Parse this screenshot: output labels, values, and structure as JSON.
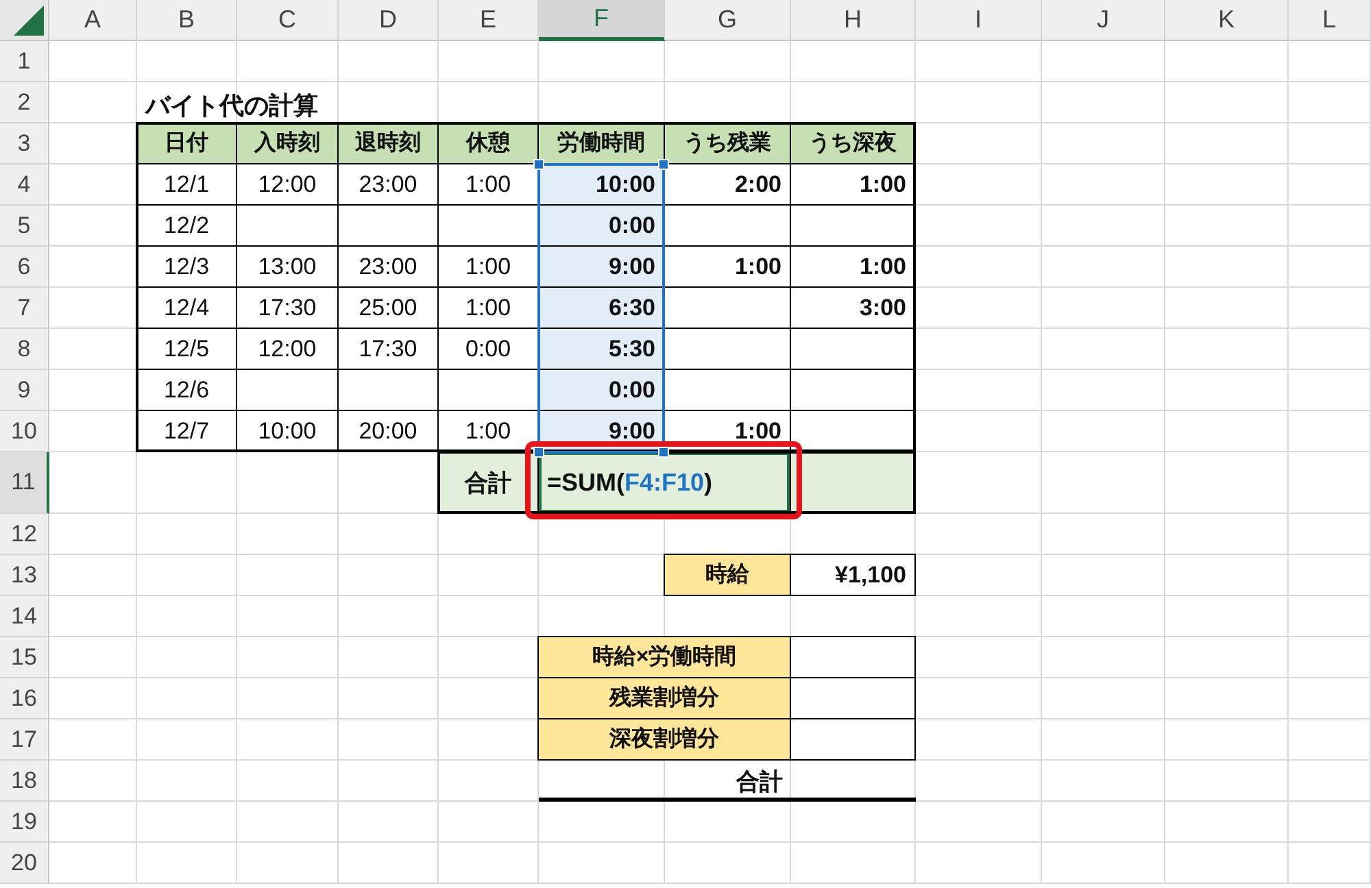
{
  "columns": [
    {
      "letter": "A",
      "selected": false
    },
    {
      "letter": "B",
      "selected": false
    },
    {
      "letter": "C",
      "selected": false
    },
    {
      "letter": "D",
      "selected": false
    },
    {
      "letter": "E",
      "selected": false
    },
    {
      "letter": "F",
      "selected": true
    },
    {
      "letter": "G",
      "selected": false
    },
    {
      "letter": "H",
      "selected": false
    },
    {
      "letter": "I",
      "selected": false
    },
    {
      "letter": "J",
      "selected": false
    },
    {
      "letter": "K",
      "selected": false
    },
    {
      "letter": "L",
      "selected": false
    }
  ],
  "rows": [
    {
      "number": "1",
      "selected": false
    },
    {
      "number": "2",
      "selected": false,
      "cells": [
        null,
        {
          "kind": "title",
          "text": "バイト代の計算",
          "selected": false
        }
      ]
    },
    {
      "number": "3",
      "selected": false,
      "cells": [
        null,
        {
          "kind": "head",
          "text": "日付",
          "selected": false
        },
        {
          "kind": "head",
          "text": "入時刻",
          "selected": false
        },
        {
          "kind": "head",
          "text": "退時刻",
          "selected": false
        },
        {
          "kind": "head",
          "text": "休憩",
          "selected": false
        },
        {
          "kind": "head",
          "text": "労働時間",
          "selected": false
        },
        {
          "kind": "head",
          "text": "うち残業",
          "selected": false
        },
        {
          "kind": "head",
          "text": "うち深夜",
          "selected": false
        }
      ]
    },
    {
      "number": "4",
      "selected": false,
      "cells": [
        null,
        {
          "kind": "entry",
          "text": "12/1",
          "selected": false
        },
        {
          "kind": "entry",
          "text": "12:00",
          "selected": false
        },
        {
          "kind": "entry",
          "text": "23:00",
          "selected": false
        },
        {
          "kind": "entry",
          "text": "1:00",
          "selected": false
        },
        {
          "kind": "calc",
          "text": "10:00",
          "selected": true
        },
        {
          "kind": "calc",
          "text": "2:00",
          "selected": false
        },
        {
          "kind": "calc",
          "text": "1:00",
          "selected": false
        }
      ]
    },
    {
      "number": "5",
      "selected": false,
      "cells": [
        null,
        {
          "kind": "entry",
          "text": "12/2",
          "selected": false
        },
        {
          "kind": "entry",
          "selected": false
        },
        {
          "kind": "entry",
          "selected": false
        },
        {
          "kind": "entry",
          "selected": false
        },
        {
          "kind": "calc",
          "text": "0:00",
          "selected": true
        },
        {
          "kind": "calc",
          "selected": false
        },
        {
          "kind": "calc",
          "selected": false
        }
      ]
    },
    {
      "number": "6",
      "selected": false,
      "cells": [
        null,
        {
          "kind": "entry",
          "text": "12/3",
          "selected": false
        },
        {
          "kind": "entry",
          "text": "13:00",
          "selected": false
        },
        {
          "kind": "entry",
          "text": "23:00",
          "selected": false
        },
        {
          "kind": "entry",
          "text": "1:00",
          "selected": false
        },
        {
          "kind": "calc",
          "text": "9:00",
          "selected": true
        },
        {
          "kind": "calc",
          "text": "1:00",
          "selected": false
        },
        {
          "kind": "calc",
          "text": "1:00",
          "selected": false
        }
      ]
    },
    {
      "number": "7",
      "selected": false,
      "cells": [
        null,
        {
          "kind": "entry",
          "text": "12/4",
          "selected": false
        },
        {
          "kind": "entry",
          "text": "17:30",
          "selected": false
        },
        {
          "kind": "entry",
          "text": "25:00",
          "selected": false
        },
        {
          "kind": "entry",
          "text": "1:00",
          "selected": false
        },
        {
          "kind": "calc",
          "text": "6:30",
          "selected": true
        },
        {
          "kind": "calc",
          "selected": false
        },
        {
          "kind": "calc",
          "text": "3:00",
          "selected": false
        }
      ]
    },
    {
      "number": "8",
      "selected": false,
      "cells": [
        null,
        {
          "kind": "entry",
          "text": "12/5",
          "selected": false
        },
        {
          "kind": "entry",
          "text": "12:00",
          "selected": false
        },
        {
          "kind": "entry",
          "text": "17:30",
          "selected": false
        },
        {
          "kind": "entry",
          "text": "0:00",
          "selected": false
        },
        {
          "kind": "calc",
          "text": "5:30",
          "selected": true
        },
        {
          "kind": "calc",
          "selected": false
        },
        {
          "kind": "calc",
          "selected": false
        }
      ]
    },
    {
      "number": "9",
      "selected": false,
      "cells": [
        null,
        {
          "kind": "entry",
          "text": "12/6",
          "selected": false
        },
        {
          "kind": "entry",
          "selected": false
        },
        {
          "kind": "entry",
          "selected": false
        },
        {
          "kind": "entry",
          "selected": false
        },
        {
          "kind": "calc",
          "text": "0:00",
          "selected": true
        },
        {
          "kind": "calc",
          "selected": false
        },
        {
          "kind": "calc",
          "selected": false
        }
      ]
    },
    {
      "number": "10",
      "selected": false,
      "cells": [
        null,
        {
          "kind": "entry",
          "text": "12/7",
          "selected": false
        },
        {
          "kind": "entry",
          "text": "10:00",
          "selected": false
        },
        {
          "kind": "entry",
          "text": "20:00",
          "selected": false
        },
        {
          "kind": "entry",
          "text": "1:00",
          "selected": false
        },
        {
          "kind": "calc",
          "text": "9:00",
          "selected": true
        },
        {
          "kind": "calc",
          "text": "1:00",
          "selected": false
        },
        {
          "kind": "calc",
          "selected": false
        }
      ]
    },
    {
      "number": "11",
      "selected": true,
      "cells": [
        null,
        null,
        null,
        null,
        {
          "kind": "sum-label",
          "text": "合計",
          "selected": false
        },
        {
          "kind": "formula",
          "parts": [
            {
              "kind": "plain",
              "text": "=SUM("
            },
            {
              "kind": "reference",
              "text": "F4:F10"
            },
            {
              "kind": "plain",
              "text": ")"
            }
          ],
          "selected": false,
          "highlighted": true
        },
        {
          "kind": "sum-blank",
          "selected": false
        }
      ]
    },
    {
      "number": "12",
      "selected": false
    },
    {
      "number": "13",
      "selected": false,
      "cells": [
        null,
        null,
        null,
        null,
        null,
        null,
        {
          "kind": "rate-label",
          "text": "時給",
          "selected": false
        },
        {
          "kind": "amount",
          "text": "¥1,100",
          "selected": false
        }
      ]
    },
    {
      "number": "14",
      "selected": false
    },
    {
      "number": "15",
      "selected": false,
      "cells": [
        null,
        null,
        null,
        null,
        null,
        {
          "kind": "field-label",
          "text": "時給×労働時間",
          "selected": false
        },
        {
          "kind": "amount",
          "selected": false
        }
      ]
    },
    {
      "number": "16",
      "selected": false,
      "cells": [
        null,
        null,
        null,
        null,
        null,
        {
          "kind": "field-label",
          "text": "残業割増分",
          "selected": false
        },
        {
          "kind": "amount",
          "selected": false
        }
      ]
    },
    {
      "number": "17",
      "selected": false,
      "cells": [
        null,
        null,
        null,
        null,
        null,
        {
          "kind": "field-label",
          "text": "深夜割増分",
          "selected": false
        },
        {
          "kind": "amount",
          "selected": false
        }
      ]
    },
    {
      "number": "18",
      "selected": false,
      "cells": [
        null,
        null,
        null,
        null,
        null,
        {
          "kind": "total",
          "text": "合計",
          "selected": false
        }
      ]
    },
    {
      "number": "19",
      "selected": false
    },
    {
      "number": "20",
      "selected": false
    }
  ]
}
